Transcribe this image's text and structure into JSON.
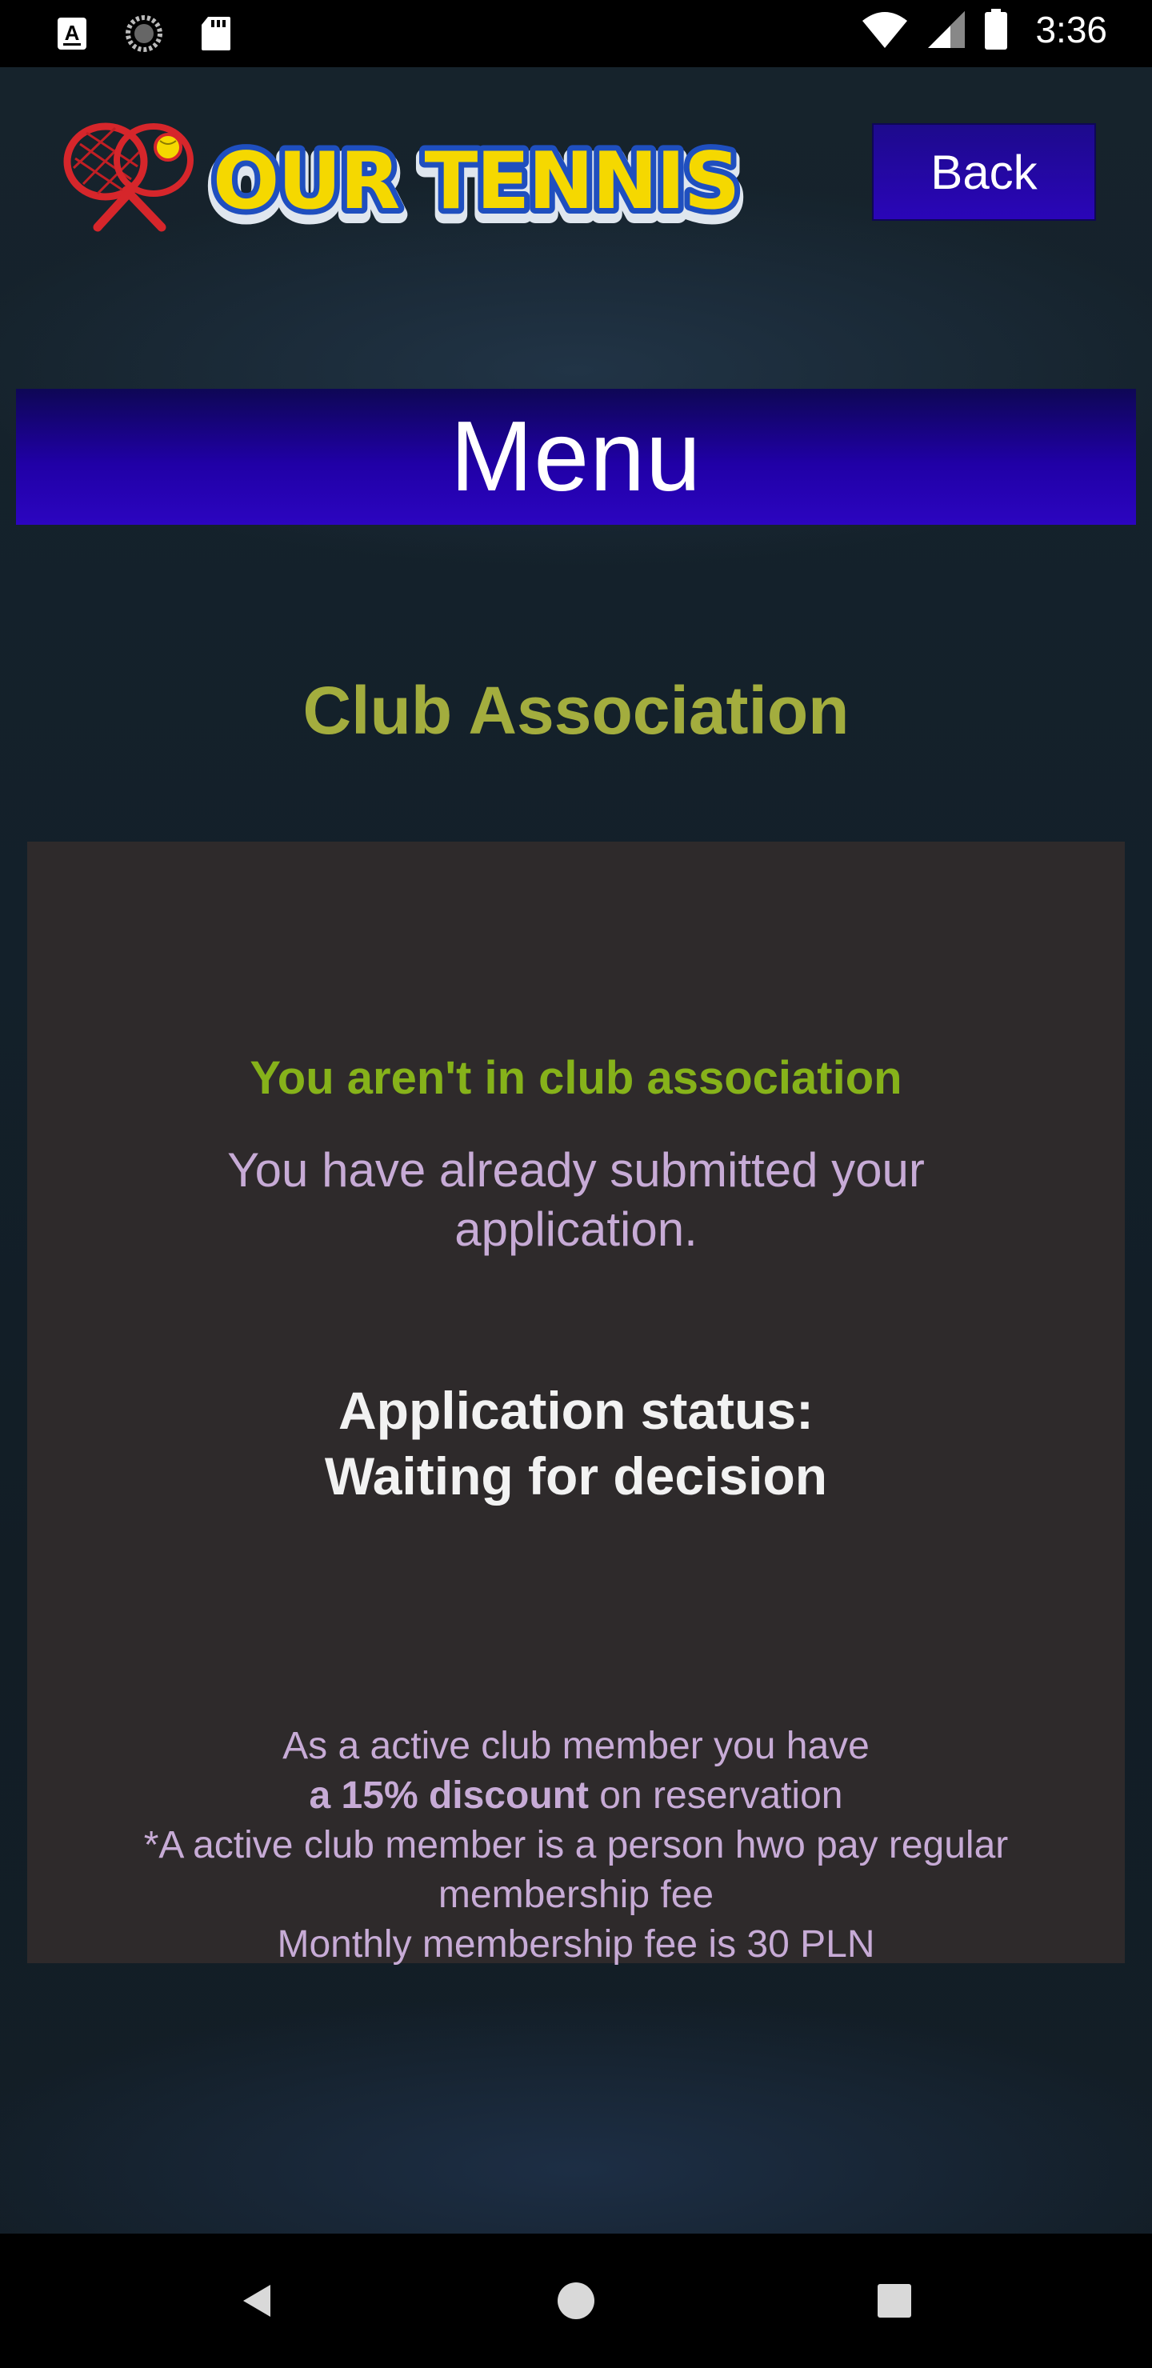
{
  "status_bar": {
    "time": "3:36",
    "icons": [
      "a-notification-icon",
      "sync-icon",
      "sd-card-icon",
      "wifi-icon",
      "signal-icon",
      "battery-icon"
    ]
  },
  "header": {
    "logo_text": "OUR TENNIS",
    "back_label": "Back"
  },
  "menu": {
    "label": "Menu"
  },
  "section": {
    "title": "Club Association"
  },
  "panel": {
    "membership_status": "You aren't in club association",
    "submitted_message": "You have already submitted your application.",
    "application_status_label": "Application status:",
    "application_status_value": "Waiting for decision",
    "info": {
      "line1": "As a active club member you have",
      "discount_bold": "a 15% discount",
      "line2_rest": " on reservation",
      "line3": "*A active club member is a person hwo pay regular membership fee",
      "line4": "Monthly membership fee is 30 PLN"
    }
  },
  "colors": {
    "accent_blue": "#2a05b8",
    "title_olive": "#a3ad3e",
    "status_green": "#86b21a",
    "text_lavender": "#c7abd6",
    "logo_yellow": "#f5d800",
    "logo_blue": "#1f4fbf"
  },
  "nav_bar": {
    "buttons": [
      "back-nav-icon",
      "home-nav-icon",
      "recents-nav-icon"
    ]
  }
}
